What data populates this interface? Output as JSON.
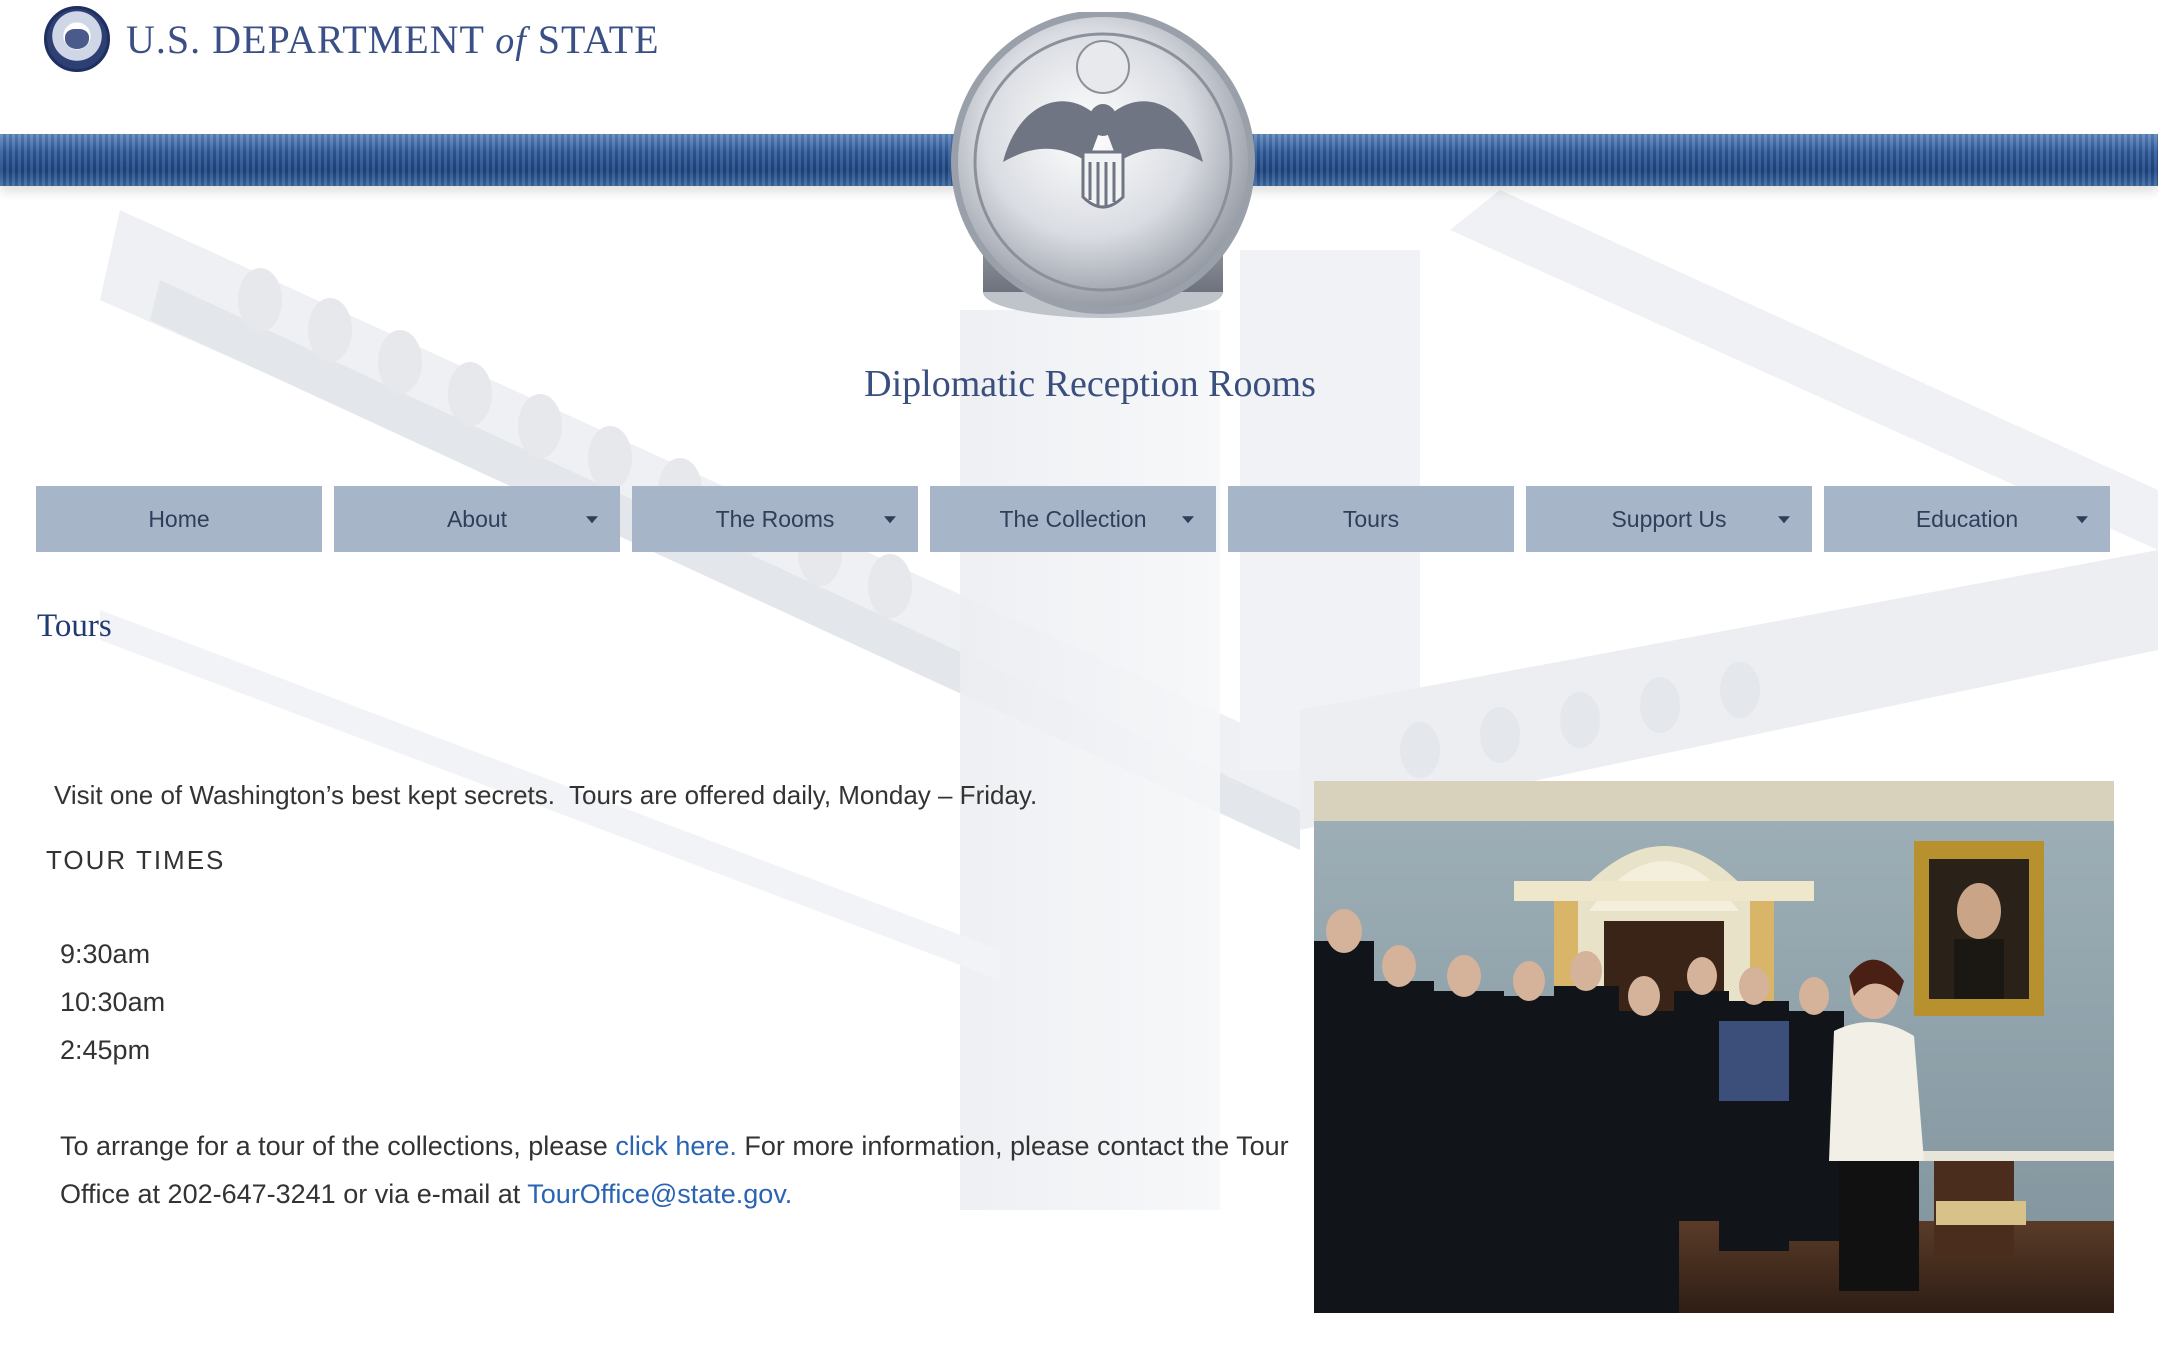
{
  "header": {
    "department_name_part1": "U.S. DEPARTMENT",
    "department_name_of": "of",
    "department_name_part2": "STATE",
    "site_title": "Diplomatic Reception Rooms"
  },
  "nav": {
    "items": [
      {
        "label": "Home",
        "has_dropdown": false
      },
      {
        "label": "About",
        "has_dropdown": true
      },
      {
        "label": "The Rooms",
        "has_dropdown": true
      },
      {
        "label": "The Collection",
        "has_dropdown": true
      },
      {
        "label": "Tours",
        "has_dropdown": false
      },
      {
        "label": "Support Us",
        "has_dropdown": true
      },
      {
        "label": "Education",
        "has_dropdown": true
      }
    ]
  },
  "main": {
    "heading": "Tours",
    "intro": "Visit one of Washington’s best kept secrets.  Tours are offered daily, Monday – Friday.",
    "tour_times_heading": "TOUR TIMES",
    "times": [
      "9:30am",
      "10:30am",
      "2:45pm"
    ],
    "arrange": {
      "text1": "To arrange for a tour of the collections, please ",
      "link1": "click here.",
      "text2": " For more information, please contact the Tour Office at 202-647-3241 or via e-mail at ",
      "link2": "TourOffice@state.gov."
    }
  },
  "colors": {
    "nav_bg": "#a7b5c9",
    "heading": "#1f3b73",
    "link": "#2a64b3",
    "band": "#2e5a9a"
  },
  "icons": {
    "dropdown": "chevron-down-icon",
    "seal": "department-seal-icon"
  }
}
